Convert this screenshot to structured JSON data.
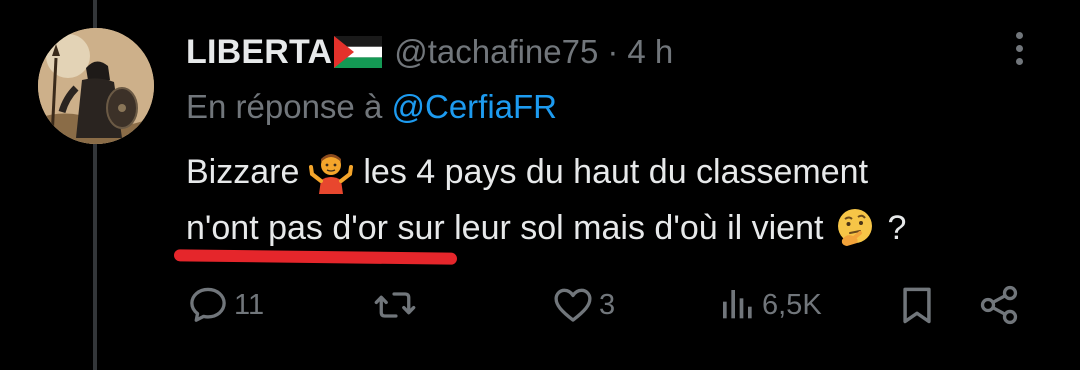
{
  "tweet": {
    "author": {
      "display_name": "LIBERTA",
      "name_emoji": "palestine-flag",
      "handle": "@tachafine75"
    },
    "separator": "·",
    "time": "4 h",
    "reply_prefix": "En réponse à",
    "reply_to": "@CerfiaFR",
    "text": {
      "line1_before_emoji": "Bizzare",
      "line1_emoji": "person-shrugging",
      "line1_after_emoji": "les 4 pays du haut du classement",
      "line2_before_emoji": "n'ont pas d'or sur leur sol mais d'où il vient",
      "line2_emoji": "thinking-face",
      "line2_after_emoji": "?"
    },
    "annotation": {
      "type": "red-underline",
      "color": "#e5262b",
      "covers_text": "n'ont pas d'or"
    },
    "actions": {
      "replies": "11",
      "retweets": "",
      "likes": "3",
      "views": "6,5K",
      "bookmark_icon": "bookmark-icon",
      "share_icon": "share-icon"
    }
  },
  "colors": {
    "background": "#000000",
    "text_primary": "#e7e9ea",
    "text_secondary": "#71767b",
    "link": "#1d9bf0",
    "thread_line": "#333639"
  }
}
